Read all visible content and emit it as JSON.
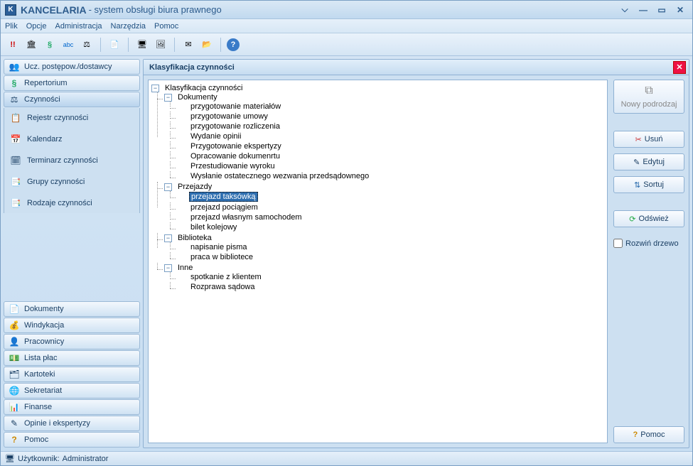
{
  "title": "KANCELARIA",
  "subtitle": "- system obsługi biura prawnego",
  "menu": {
    "items": [
      "Plik",
      "Opcje",
      "Administracja",
      "Narzędzia",
      "Pomoc"
    ]
  },
  "sidebar": {
    "top": [
      {
        "label": "Ucz. postępow./dostawcy",
        "icon": "👥"
      },
      {
        "label": "Repertorium",
        "icon": "§"
      },
      {
        "label": "Czynności",
        "icon": "⚖"
      }
    ],
    "sub": [
      {
        "label": "Rejestr czynności",
        "icon": "📋"
      },
      {
        "label": "Kalendarz",
        "icon": "📅"
      },
      {
        "label": "Terminarz czynności",
        "icon": "🗓"
      },
      {
        "label": "Grupy czynności",
        "icon": "📑"
      },
      {
        "label": "Rodzaje czynności",
        "icon": "📑"
      }
    ],
    "bottom": [
      {
        "label": "Dokumenty",
        "icon": "📄"
      },
      {
        "label": "Windykacja",
        "icon": "💰"
      },
      {
        "label": "Pracownicy",
        "icon": "👤"
      },
      {
        "label": "Lista płac",
        "icon": "💵"
      },
      {
        "label": "Kartoteki",
        "icon": "🗂"
      },
      {
        "label": "Sekretariat",
        "icon": "🌐"
      },
      {
        "label": "Finanse",
        "icon": "📊"
      },
      {
        "label": "Opinie i ekspertyzy",
        "icon": "✎"
      },
      {
        "label": "Pomoc",
        "icon": "?"
      }
    ]
  },
  "panel": {
    "title": "Klasyfikacja czynności",
    "tree": {
      "root": "Klasyfikacja czynności",
      "n0": "Dokumenty",
      "n00": "przygotowanie materiałów",
      "n01": "przygotowanie umowy",
      "n02": "przygotowanie rozliczenia",
      "n03": "Wydanie opinii",
      "n04": "Przygotowanie ekspertyzy",
      "n05": "Opracowanie dokumenrtu",
      "n06": "Przestudiowanie wyroku",
      "n07": "Wysłanie ostatecznego wezwania przedsądownego",
      "n1": "Przejazdy",
      "n10": "przejazd taksówką",
      "n11": "przejazd pociągiem",
      "n12": "przejazd własnym samochodem",
      "n13": "bilet kolejowy",
      "n2": "Biblioteka",
      "n20": "napisanie pisma",
      "n21": "praca w bibliotece",
      "n3": "Inne",
      "n30": "spotkanie z klientem",
      "n31": "Rozprawa sądowa"
    }
  },
  "actions": {
    "nowy": "Nowy podrodzaj",
    "usun": "Usuń",
    "edytuj": "Edytuj",
    "sortuj": "Sortuj",
    "odswiez": "Odśwież",
    "rozwin": "Rozwiń drzewo",
    "pomoc": "Pomoc"
  },
  "status": {
    "user_label": "Użytkownik:",
    "user": "Administrator"
  }
}
